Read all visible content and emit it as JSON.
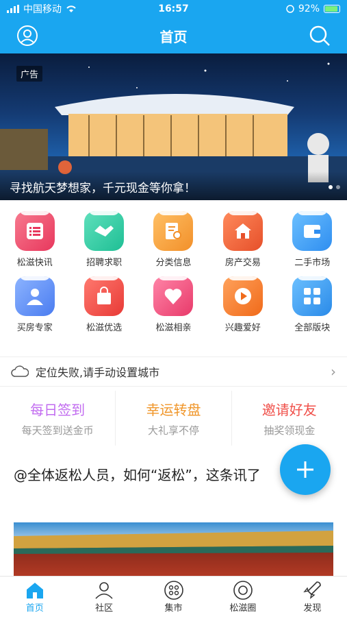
{
  "status": {
    "carrier": "中国移动",
    "time": "16:57",
    "battery": "92%"
  },
  "header": {
    "title": "首页"
  },
  "banner": {
    "ad_tag": "广告",
    "caption": "寻找航天梦想家，千元现金等你拿！"
  },
  "grid": [
    {
      "label": "松滋快讯",
      "icon": "news-list-icon",
      "color": "#f2546f"
    },
    {
      "label": "招聘求职",
      "icon": "handshake-icon",
      "color": "#36d1a4"
    },
    {
      "label": "分类信息",
      "icon": "document-search-icon",
      "color": "#f7a43b"
    },
    {
      "label": "房产交易",
      "icon": "house-icon",
      "color": "#f06a3c"
    },
    {
      "label": "二手市场",
      "icon": "wallet-icon",
      "color": "#3a9df0"
    },
    {
      "label": "买房专家",
      "icon": "person-icon",
      "color": "#5a8ff0"
    },
    {
      "label": "松滋优选",
      "icon": "shopping-bag-icon",
      "color": "#ef4a47"
    },
    {
      "label": "松滋相亲",
      "icon": "heart-icon",
      "color": "#f0507c"
    },
    {
      "label": "兴趣爱好",
      "icon": "play-icon",
      "color": "#f57a2b"
    },
    {
      "label": "全部版块",
      "icon": "grid-blocks-icon",
      "color": "#2f9ef0"
    }
  ],
  "location": {
    "text": "定位失败,请手动设置城市"
  },
  "promo": [
    {
      "title": "每日签到",
      "sub": "每天签到送金币",
      "color": "#c26cf0"
    },
    {
      "title": "幸运转盘",
      "sub": "大礼享不停",
      "color": "#f0962a"
    },
    {
      "title": "邀请好友",
      "sub": "抽奖领现金",
      "color": "#f0504a"
    }
  ],
  "feed": {
    "title": "@全体返松人员，如何“返松”，这条讯了"
  },
  "tabs": [
    {
      "label": "首页",
      "icon": "home-icon"
    },
    {
      "label": "社区",
      "icon": "community-icon"
    },
    {
      "label": "集市",
      "icon": "market-icon"
    },
    {
      "label": "松滋圈",
      "icon": "circle-icon"
    },
    {
      "label": "发现",
      "icon": "rocket-icon"
    }
  ],
  "colors": {
    "primary": "#1aa6f0"
  }
}
